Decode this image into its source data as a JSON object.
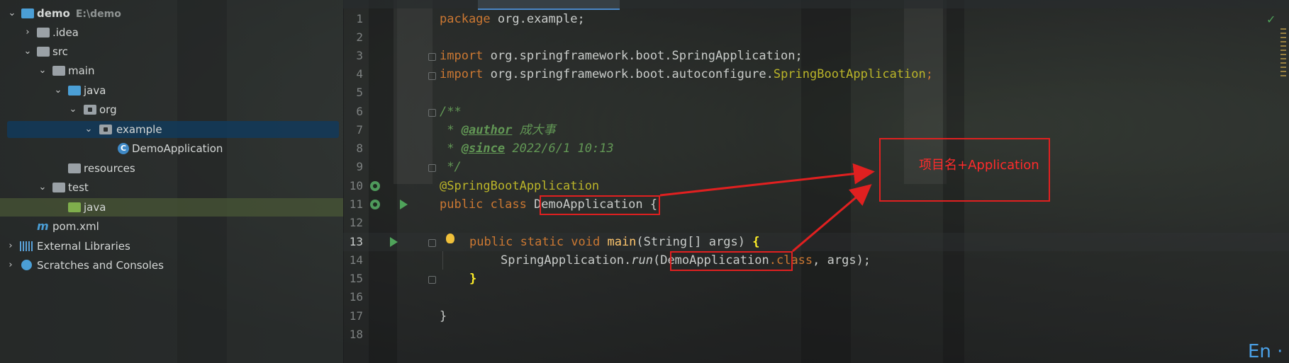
{
  "project_tree": {
    "root": {
      "label": "demo",
      "path_hint": "E:\\demo"
    },
    "items": [
      {
        "label": ".idea"
      },
      {
        "label": "src"
      },
      {
        "label": "main"
      },
      {
        "label": "java"
      },
      {
        "label": "org"
      },
      {
        "label": "example"
      },
      {
        "label": "DemoApplication"
      },
      {
        "label": "resources"
      },
      {
        "label": "test"
      },
      {
        "label": "java"
      },
      {
        "label": "pom.xml"
      },
      {
        "label": "External Libraries"
      },
      {
        "label": "Scratches and Consoles"
      }
    ],
    "selected": "example"
  },
  "editor": {
    "line_numbers": [
      "1",
      "2",
      "3",
      "4",
      "5",
      "6",
      "7",
      "8",
      "9",
      "10",
      "11",
      "12",
      "13",
      "14",
      "15",
      "16",
      "17",
      "18"
    ],
    "current_line": "13",
    "code": {
      "l1": {
        "kw": "package",
        "rest": " org.example;"
      },
      "l3": {
        "kw": "import",
        "rest": " org.springframework.boot.SpringApplication;"
      },
      "l4": {
        "kw": "import",
        "pkg": " org.springframework.boot.autoconfigure.",
        "cls": "SpringBootApplication",
        "semi": ";"
      },
      "l6": "/**",
      "l7": {
        "star": " * ",
        "tag": "@author",
        "text": " 成大事"
      },
      "l8": {
        "star": " * ",
        "tag": "@since",
        "text": " 2022/6/1 10:13"
      },
      "l9": " */",
      "l10": "@SpringBootApplication",
      "l11": {
        "kw": "public class ",
        "cls": "DemoApplication",
        "rest": " {"
      },
      "l13": {
        "kw": "public static void ",
        "fn": "main",
        "params": "(String[] args) ",
        "brace": "{"
      },
      "l14": {
        "obj": "SpringApplication.",
        "fn": "run",
        "open": "(",
        "cls": "DemoApplication",
        "dot_class": ".class",
        "rest": ", args);"
      },
      "l15": "}",
      "l17": "}"
    }
  },
  "annotation": {
    "text": "项目名+Application"
  },
  "status": {
    "ime": "En ·"
  },
  "colors": {
    "highlight_red": "#e02020",
    "selection_blue": "#123a5a",
    "keyword": "#cc7832",
    "annotation": "#bbb529",
    "comment": "#629755"
  }
}
